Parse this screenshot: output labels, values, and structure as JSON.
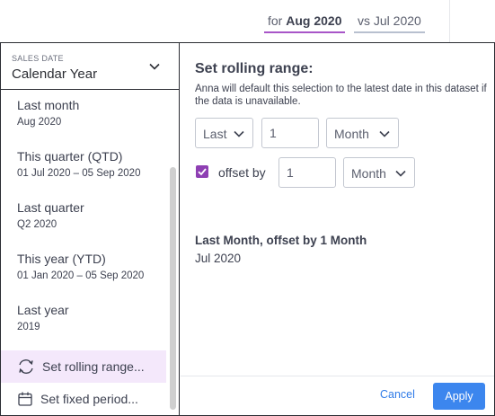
{
  "header": {
    "for_prefix": "for",
    "for_value": "Aug 2020",
    "vs_label": "vs Jul 2020"
  },
  "date_field": {
    "label": "SALES DATE",
    "value": "Calendar Year"
  },
  "presets": [
    {
      "title": "Last month",
      "subtitle": "Aug 2020"
    },
    {
      "title": "This quarter (QTD)",
      "subtitle": "01 Jul 2020 – 05 Sep 2020"
    },
    {
      "title": "Last quarter",
      "subtitle": "Q2 2020"
    },
    {
      "title": "This year (YTD)",
      "subtitle": "01 Jan 2020 – 05 Sep 2020"
    },
    {
      "title": "Last year",
      "subtitle": "2019"
    }
  ],
  "actions": {
    "rolling": "Set rolling range...",
    "fixed": "Set fixed period..."
  },
  "rolling": {
    "title": "Set rolling range:",
    "help": "Anna will default this selection to the latest date in this dataset if the data is unavailable.",
    "direction": "Last",
    "amount": "1",
    "unit": "Month",
    "offset_label": "offset by",
    "offset_checked": true,
    "offset_amount": "1",
    "offset_unit": "Month"
  },
  "summary": {
    "title": "Last Month, offset by 1 Month",
    "value": "Jul 2020"
  },
  "footer": {
    "cancel": "Cancel",
    "apply": "Apply"
  },
  "colors": {
    "accent_purple": "#8e3fb3",
    "active_bg": "#f4e8fb",
    "apply_blue": "#3c86ee",
    "link_blue": "#2f7be8"
  }
}
